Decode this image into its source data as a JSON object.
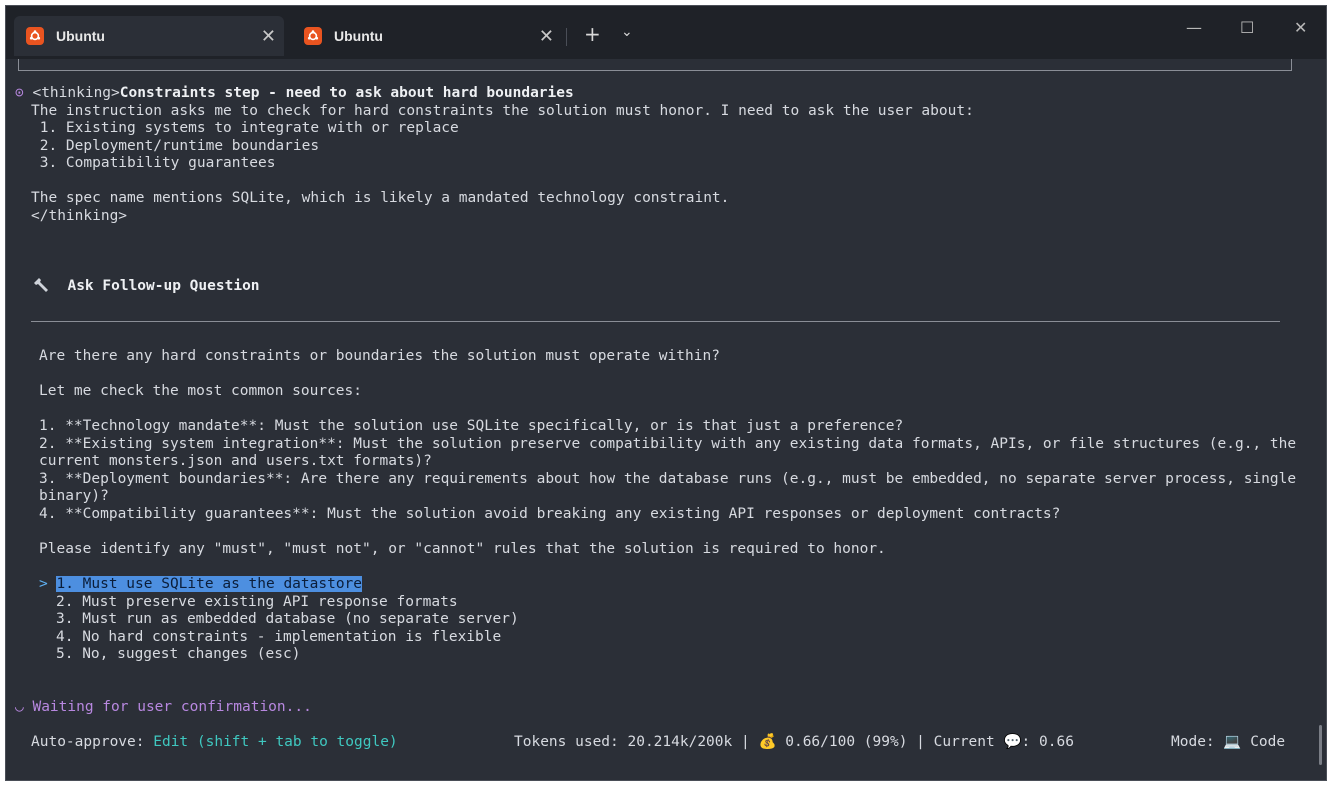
{
  "tabs": [
    {
      "label": "Ubuntu",
      "active": true
    },
    {
      "label": "Ubuntu",
      "active": false
    }
  ],
  "titlebar": {
    "close_tab": "✕",
    "new_tab": "+",
    "dropdown": "⌄",
    "minimize": "—",
    "maximize": "☐",
    "close": "✕"
  },
  "thinking": {
    "icon": "⊙",
    "open_tag": "<thinking>",
    "title": "Constraints step - need to ask about hard boundaries",
    "lines": [
      "The instruction asks me to check for hard constraints the solution must honor. I need to ask the user about:",
      " 1. Existing systems to integrate with or replace",
      " 2. Deployment/runtime boundaries",
      " 3. Compatibility guarantees",
      "The spec name mentions SQLite, which is likely a mandated technology constraint.",
      "</thinking>"
    ]
  },
  "followup": {
    "icon": "wrench-icon",
    "title": "Ask Follow-up Question",
    "question": "Are there any hard constraints or boundaries the solution must operate within?",
    "intro": "Let me check the most common sources:",
    "items": [
      "1. **Technology mandate**: Must the solution use SQLite specifically, or is that just a preference?",
      "2. **Existing system integration**: Must the solution preserve compatibility with any existing data formats, APIs, or file structures (e.g., the",
      "current monsters.json and users.txt formats)?",
      "3. **Deployment boundaries**: Are there any requirements about how the database runs (e.g., must be embedded, no separate server process, single",
      "binary)?",
      "4. **Compatibility guarantees**: Must the solution avoid breaking any existing API responses or deployment contracts?"
    ],
    "closing": "Please identify any \"must\", \"must not\", or \"cannot\" rules that the solution is required to honor.",
    "options": [
      "1. Must use SQLite as the datastore",
      "2. Must preserve existing API response formats",
      "3. Must run as embedded database (no separate server)",
      "4. No hard constraints - implementation is flexible",
      "5. No, suggest changes (esc)"
    ],
    "selected_index": 0
  },
  "status": {
    "spinner": "◡",
    "waiting": "Waiting for user confirmation...",
    "auto_approve_label": "Auto-approve:",
    "auto_approve_value": "Edit (shift + tab to toggle)",
    "tokens_label": "Tokens used: 20.214k/200k |",
    "cost_icon": "💰",
    "cost": "0.66/100 (99%) | Current",
    "chat_icon": "💬",
    "current": ": 0.66",
    "mode_label": "Mode:",
    "mode_icon": "💻",
    "mode_value": "Code"
  },
  "colors": {
    "background": "#2b2f37",
    "accent_purple": "#b888e0",
    "accent_cyan": "#3fc8c0",
    "selection": "#4d8fe0",
    "ubuntu_orange": "#e95420"
  }
}
